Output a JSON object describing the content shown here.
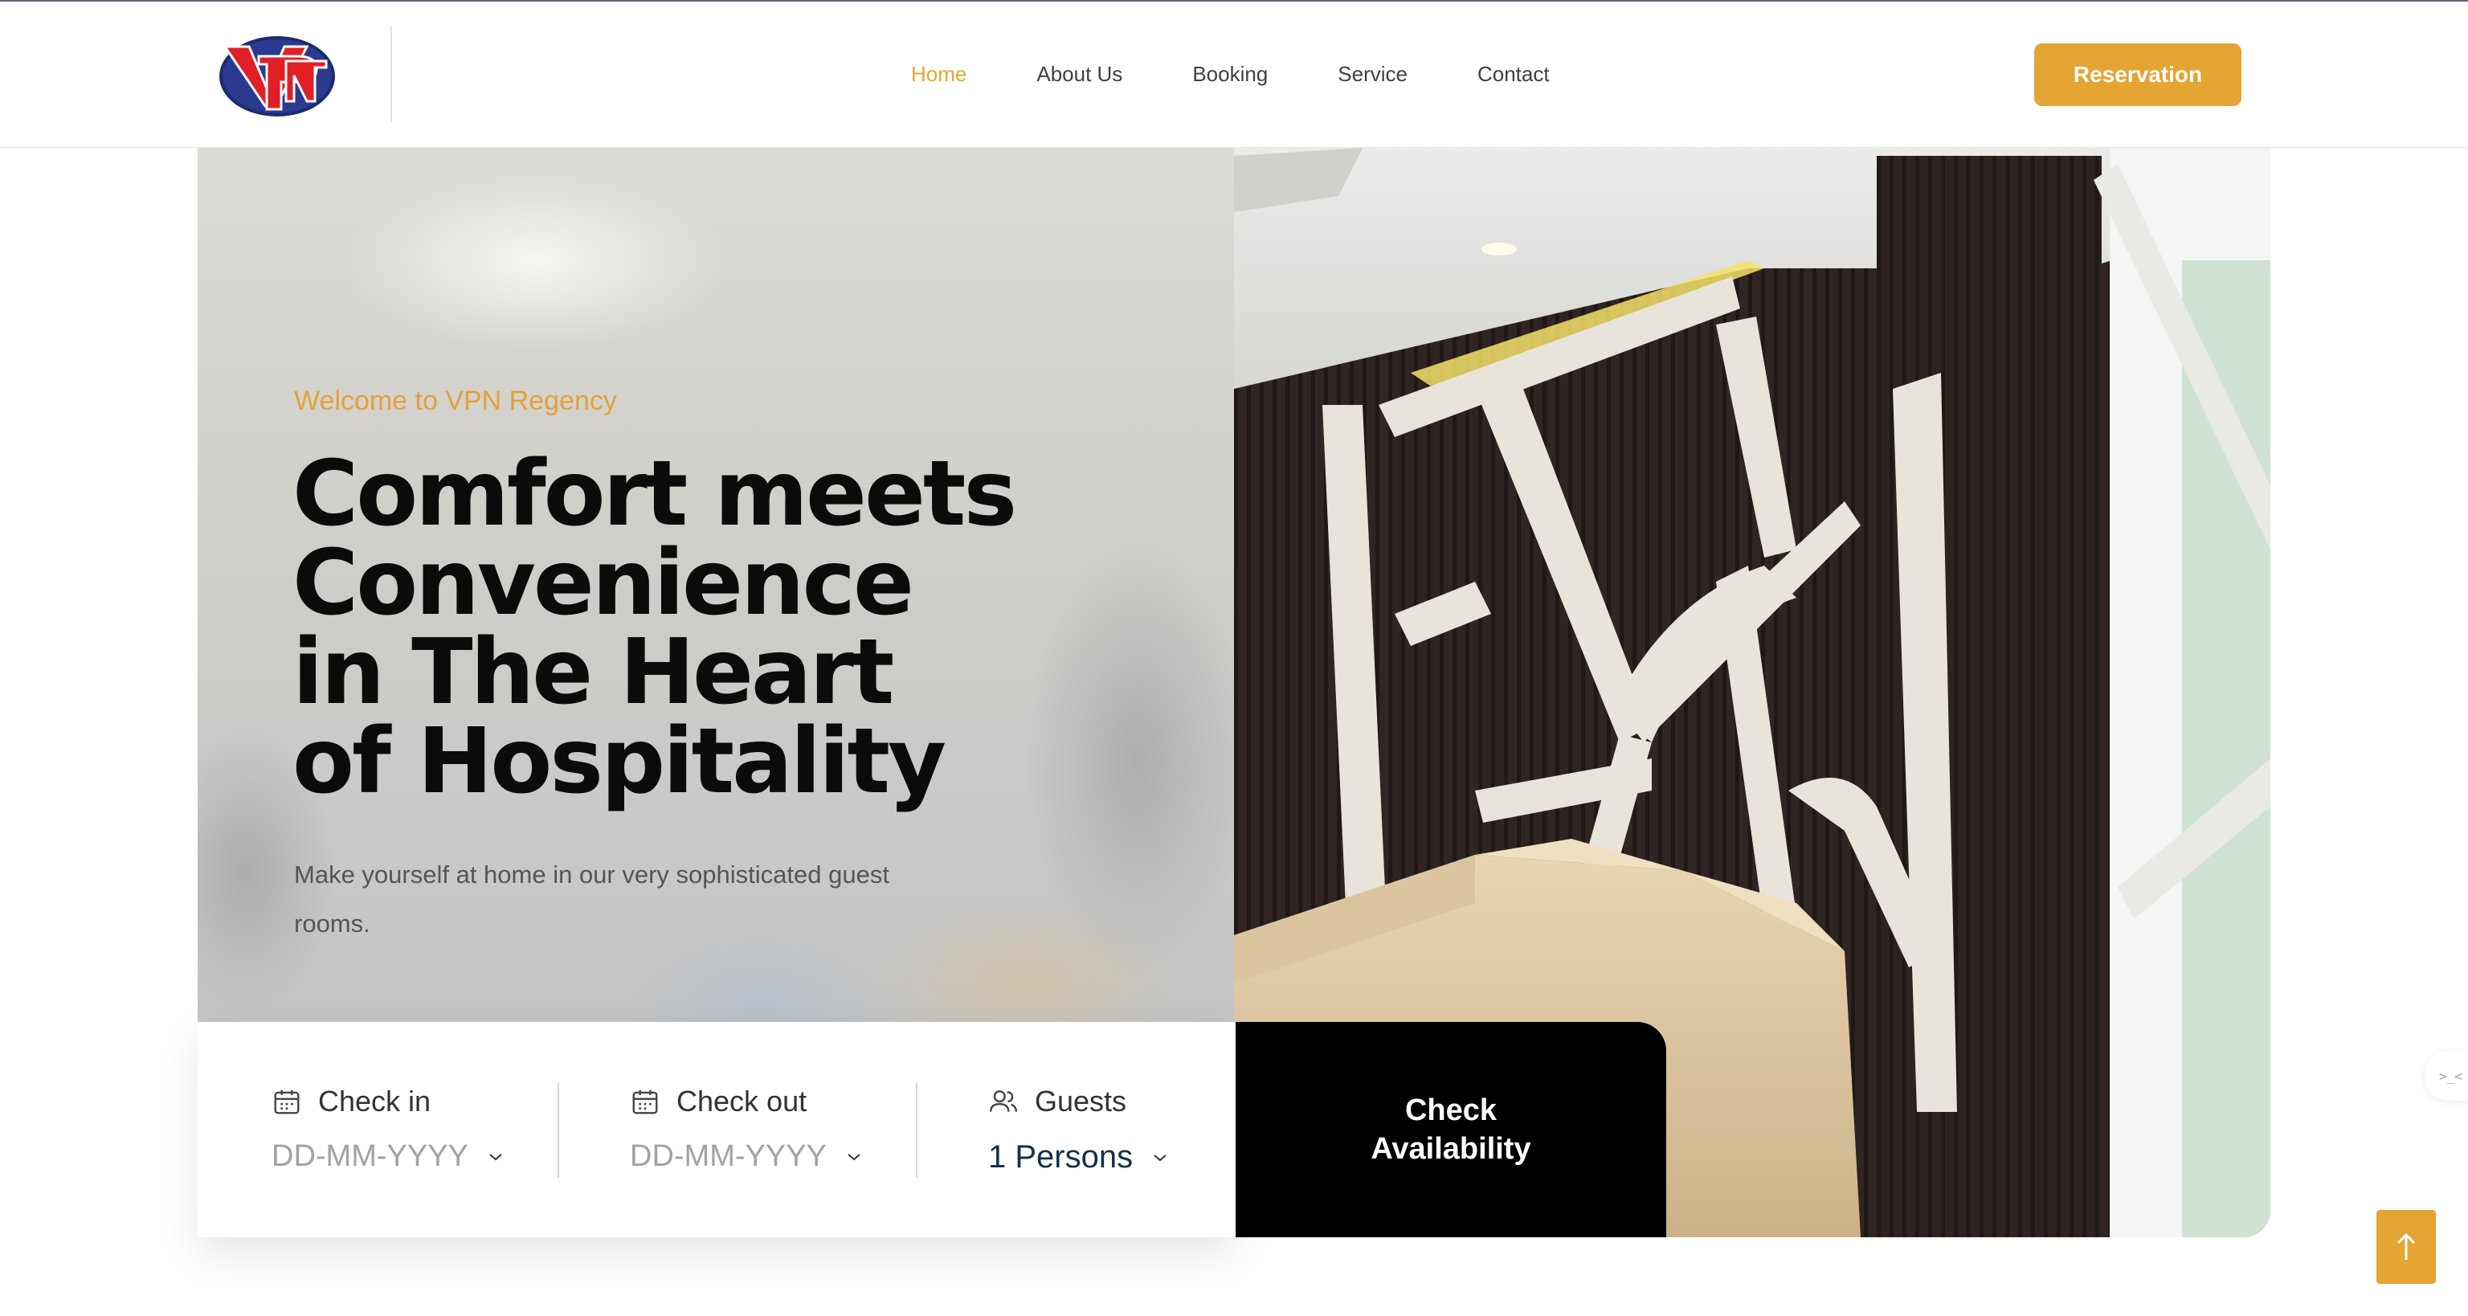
{
  "header": {
    "logo_icon": "vpn-monogram-logo",
    "nav": [
      {
        "label": "Home",
        "active": true
      },
      {
        "label": "About Us",
        "active": false
      },
      {
        "label": "Booking",
        "active": false
      },
      {
        "label": "Service",
        "active": false
      },
      {
        "label": "Contact",
        "active": false
      }
    ],
    "reservation_label": "Reservation"
  },
  "hero": {
    "eyebrow": "Welcome to VPN Regency",
    "headline": "Comfort meets Convenience in The Heart of Hospitality",
    "subtext": "Make yourself at home in our very sophisticated guest rooms."
  },
  "booking": {
    "check_in": {
      "label": "Check in",
      "placeholder": "DD-MM-YYYY",
      "icon": "calendar-icon"
    },
    "check_out": {
      "label": "Check out",
      "placeholder": "DD-MM-YYYY",
      "icon": "calendar-icon"
    },
    "guests": {
      "label": "Guests",
      "value": "1 Persons",
      "icon": "users-icon"
    },
    "submit_label": "Check Availability"
  },
  "side_tab": {
    "text": ">_<"
  },
  "colors": {
    "accent": "#e4a533",
    "nav_active": "#e8a52e",
    "button_dark": "#000000",
    "guests_value": "#14324a"
  }
}
